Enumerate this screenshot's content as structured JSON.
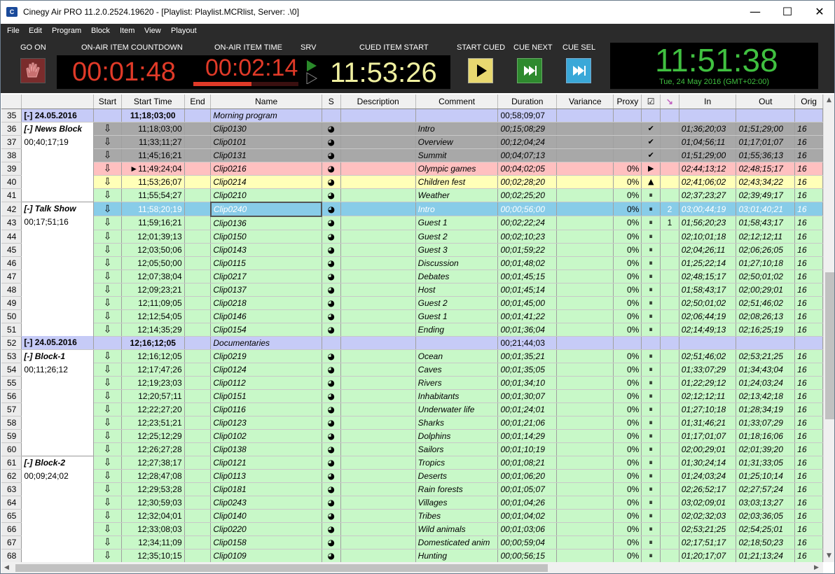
{
  "window": {
    "title": "Cinegy Air PRO 11.2.0.2524.19620 - [Playlist: Playlist.MCRlist, Server: .\\0]",
    "minimize": "—",
    "maximize": "☐",
    "close": "✕"
  },
  "menu": [
    "File",
    "Edit",
    "Program",
    "Block",
    "Item",
    "View",
    "Playout"
  ],
  "toolbar": {
    "go_on_label": "GO ON",
    "countdown_label": "ON-AIR ITEM COUNTDOWN",
    "countdown_value": "00:01:48",
    "item_time_label": "ON-AIR ITEM TIME",
    "item_time_value": "00:02:14",
    "item_progress": 0.55,
    "srv_label": "SRV",
    "cued_label": "CUED ITEM START",
    "cued_value": "11:53:26",
    "start_cued_label": "START CUED",
    "cue_next_label": "CUE NEXT",
    "cue_sel_label": "CUE SEL",
    "clock_time": "11:51:38",
    "clock_date": "Tue, 24 May 2016 (GMT+02:00)"
  },
  "colors": {
    "header_row": "#c6cbf7",
    "done_row": "#a8a8a8",
    "onair_row": "#ffc0c0",
    "cued_row": "#ffffb8",
    "ok_row": "#c8f8c8",
    "selected_row": "#88cce8",
    "clock_green": "#40c040",
    "countdown_red": "#e03a28",
    "cued_yellow": "#f0f0a0"
  },
  "columns": [
    "",
    "",
    "Start",
    "Start Time",
    "End",
    "Name",
    "S",
    "Description",
    "Comment",
    "Duration",
    "Variance",
    "Proxy",
    "☑",
    "↘",
    "In",
    "Out",
    "Orig"
  ],
  "rows": [
    {
      "n": "35",
      "type": "header",
      "block": "[-]  24.05.2016",
      "start": "",
      "time": "11;18;03;00",
      "name": "Morning program",
      "comment": "",
      "dur": "00;58;09;07",
      "proxy": "",
      "chk": "",
      "sel": "",
      "in": "",
      "out": "",
      "orig": ""
    },
    {
      "n": "36",
      "type": "done",
      "block": "[-]  News Block",
      "block2": "00;40;17;19",
      "blockstart": true,
      "start": "⇩",
      "time": "11;18;03;00",
      "name": "Clip0130",
      "s": "◕",
      "comment": "Intro",
      "dur": "00;15;08;29",
      "proxy": "",
      "chk": "✔",
      "sel": "",
      "in": "01;36;20;03",
      "out": "01;51;29;00",
      "orig": "16"
    },
    {
      "n": "37",
      "type": "done",
      "start": "⇩",
      "time": "11;33;11;27",
      "name": "Clip0101",
      "s": "◕",
      "comment": "Overview",
      "dur": "00;12;04;24",
      "proxy": "",
      "chk": "✔",
      "sel": "",
      "in": "01;04;56;11",
      "out": "01;17;01;07",
      "orig": "16"
    },
    {
      "n": "38",
      "type": "done",
      "start": "⇩",
      "time": "11;45;16;21",
      "name": "Clip0131",
      "s": "◕",
      "comment": "Summit",
      "dur": "00;04;07;13",
      "proxy": "",
      "chk": "✔",
      "sel": "",
      "in": "01;51;29;00",
      "out": "01;55;36;13",
      "orig": "16"
    },
    {
      "n": "39",
      "type": "onair",
      "start": "⇩",
      "time": "►11;49;24;04",
      "name": "Clip0216",
      "s": "◕",
      "comment": "Olympic games",
      "dur": "00;04;02;05",
      "proxy": "0%",
      "chk": "▶",
      "sel": "",
      "in": "02;44;13;12",
      "out": "02;48;15;17",
      "orig": "16"
    },
    {
      "n": "40",
      "type": "cued",
      "start": "⇩",
      "time": "11;53;26;07",
      "name": "Clip0214",
      "s": "◕",
      "comment": "Children fest",
      "dur": "00;02;28;20",
      "proxy": "0%",
      "chk": "▲",
      "sel": "",
      "in": "02;41;06;02",
      "out": "02;43;34;22",
      "orig": "16"
    },
    {
      "n": "41",
      "type": "ok",
      "start": "⇩",
      "time": "11;55;54;27",
      "name": "Clip0210",
      "s": "◕",
      "comment": "Weather",
      "dur": "00;02;25;20",
      "proxy": "0%",
      "chk": "⏸",
      "sel": "",
      "in": "02;37;23;27",
      "out": "02;39;49;17",
      "orig": "16"
    },
    {
      "n": "42",
      "type": "selected",
      "block": "[-]  Talk Show",
      "block2": "00;17;51;16",
      "blockstart": true,
      "start": "⇩",
      "time": "11;58;20;19",
      "name": "Clip0240",
      "s": "◕",
      "comment": "Intro",
      "dur": "00;00;56;00",
      "proxy": "0%",
      "chk": "⏸",
      "sel": "2",
      "in": "03;00;44;19",
      "out": "03;01;40;21",
      "orig": "16"
    },
    {
      "n": "43",
      "type": "ok",
      "start": "⇩",
      "time": "11;59;16;21",
      "name": "Clip0136",
      "s": "◕",
      "comment": "Guest 1",
      "dur": "00;02;22;24",
      "proxy": "0%",
      "chk": "⏸",
      "sel": "1",
      "in": "01;56;20;23",
      "out": "01;58;43;17",
      "orig": "16"
    },
    {
      "n": "44",
      "type": "ok",
      "start": "⇩",
      "time": "12;01;39;13",
      "name": "Clip0150",
      "s": "◕",
      "comment": "Guest 2",
      "dur": "00;02;10;23",
      "proxy": "0%",
      "chk": "⏸",
      "sel": "",
      "in": "02;10;01;18",
      "out": "02;12;12;11",
      "orig": "16"
    },
    {
      "n": "45",
      "type": "ok",
      "start": "⇩",
      "time": "12;03;50;06",
      "name": "Clip0143",
      "s": "◕",
      "comment": "Guest 3",
      "dur": "00;01;59;22",
      "proxy": "0%",
      "chk": "⏸",
      "sel": "",
      "in": "02;04;26;11",
      "out": "02;06;26;05",
      "orig": "16"
    },
    {
      "n": "46",
      "type": "ok",
      "start": "⇩",
      "time": "12;05;50;00",
      "name": "Clip0115",
      "s": "◕",
      "comment": "Discussion",
      "dur": "00;01;48;02",
      "proxy": "0%",
      "chk": "⏸",
      "sel": "",
      "in": "01;25;22;14",
      "out": "01;27;10;18",
      "orig": "16"
    },
    {
      "n": "47",
      "type": "ok",
      "start": "⇩",
      "time": "12;07;38;04",
      "name": "Clip0217",
      "s": "◕",
      "comment": "Debates",
      "dur": "00;01;45;15",
      "proxy": "0%",
      "chk": "⏸",
      "sel": "",
      "in": "02;48;15;17",
      "out": "02;50;01;02",
      "orig": "16"
    },
    {
      "n": "48",
      "type": "ok",
      "start": "⇩",
      "time": "12;09;23;21",
      "name": "Clip0137",
      "s": "◕",
      "comment": "Host",
      "dur": "00;01;45;14",
      "proxy": "0%",
      "chk": "⏸",
      "sel": "",
      "in": "01;58;43;17",
      "out": "02;00;29;01",
      "orig": "16"
    },
    {
      "n": "49",
      "type": "ok",
      "start": "⇩",
      "time": "12;11;09;05",
      "name": "Clip0218",
      "s": "◕",
      "comment": "Guest 2",
      "dur": "00;01;45;00",
      "proxy": "0%",
      "chk": "⏸",
      "sel": "",
      "in": "02;50;01;02",
      "out": "02;51;46;02",
      "orig": "16"
    },
    {
      "n": "50",
      "type": "ok",
      "start": "⇩",
      "time": "12;12;54;05",
      "name": "Clip0146",
      "s": "◕",
      "comment": "Guest 1",
      "dur": "00;01;41;22",
      "proxy": "0%",
      "chk": "⏸",
      "sel": "",
      "in": "02;06;44;19",
      "out": "02;08;26;13",
      "orig": "16"
    },
    {
      "n": "51",
      "type": "ok",
      "start": "⇩",
      "time": "12;14;35;29",
      "name": "Clip0154",
      "s": "◕",
      "comment": "Ending",
      "dur": "00;01;36;04",
      "proxy": "0%",
      "chk": "⏸",
      "sel": "",
      "in": "02;14;49;13",
      "out": "02;16;25;19",
      "orig": "16"
    },
    {
      "n": "52",
      "type": "header",
      "block": "[-]  24.05.2016",
      "start": "",
      "time": "12;16;12;05",
      "name": "Documentaries",
      "comment": "",
      "dur": "00;21;44;03",
      "proxy": "",
      "chk": "",
      "sel": "",
      "in": "",
      "out": "",
      "orig": ""
    },
    {
      "n": "53",
      "type": "ok",
      "block": "[-]  Block-1",
      "block2": "00;11;26;12",
      "blockstart": true,
      "start": "⇩",
      "time": "12;16;12;05",
      "name": "Clip0219",
      "s": "◕",
      "comment": "Ocean",
      "dur": "00;01;35;21",
      "proxy": "0%",
      "chk": "⏸",
      "sel": "",
      "in": "02;51;46;02",
      "out": "02;53;21;25",
      "orig": "16"
    },
    {
      "n": "54",
      "type": "ok",
      "start": "⇩",
      "time": "12;17;47;26",
      "name": "Clip0124",
      "s": "◕",
      "comment": "Caves",
      "dur": "00;01;35;05",
      "proxy": "0%",
      "chk": "⏸",
      "sel": "",
      "in": "01;33;07;29",
      "out": "01;34;43;04",
      "orig": "16"
    },
    {
      "n": "55",
      "type": "ok",
      "start": "⇩",
      "time": "12;19;23;03",
      "name": "Clip0112",
      "s": "◕",
      "comment": "Rivers",
      "dur": "00;01;34;10",
      "proxy": "0%",
      "chk": "⏸",
      "sel": "",
      "in": "01;22;29;12",
      "out": "01;24;03;24",
      "orig": "16"
    },
    {
      "n": "56",
      "type": "ok",
      "start": "⇩",
      "time": "12;20;57;11",
      "name": "Clip0151",
      "s": "◕",
      "comment": "Inhabitants",
      "dur": "00;01;30;07",
      "proxy": "0%",
      "chk": "⏸",
      "sel": "",
      "in": "02;12;12;11",
      "out": "02;13;42;18",
      "orig": "16"
    },
    {
      "n": "57",
      "type": "ok",
      "start": "⇩",
      "time": "12;22;27;20",
      "name": "Clip0116",
      "s": "◕",
      "comment": "Underwater life",
      "dur": "00;01;24;01",
      "proxy": "0%",
      "chk": "⏸",
      "sel": "",
      "in": "01;27;10;18",
      "out": "01;28;34;19",
      "orig": "16"
    },
    {
      "n": "58",
      "type": "ok",
      "start": "⇩",
      "time": "12;23;51;21",
      "name": "Clip0123",
      "s": "◕",
      "comment": "Sharks",
      "dur": "00;01;21;06",
      "proxy": "0%",
      "chk": "⏸",
      "sel": "",
      "in": "01;31;46;21",
      "out": "01;33;07;29",
      "orig": "16"
    },
    {
      "n": "59",
      "type": "ok",
      "start": "⇩",
      "time": "12;25;12;29",
      "name": "Clip0102",
      "s": "◕",
      "comment": "Dolphins",
      "dur": "00;01;14;29",
      "proxy": "0%",
      "chk": "⏸",
      "sel": "",
      "in": "01;17;01;07",
      "out": "01;18;16;06",
      "orig": "16"
    },
    {
      "n": "60",
      "type": "ok",
      "start": "⇩",
      "time": "12;26;27;28",
      "name": "Clip0138",
      "s": "◕",
      "comment": "Sailors",
      "dur": "00;01;10;19",
      "proxy": "0%",
      "chk": "⏸",
      "sel": "",
      "in": "02;00;29;01",
      "out": "02;01;39;20",
      "orig": "16"
    },
    {
      "n": "61",
      "type": "ok",
      "block": "[-]  Block-2",
      "block2": "00;09;24;02",
      "blockstart": true,
      "start": "⇩",
      "time": "12;27;38;17",
      "name": "Clip0121",
      "s": "◕",
      "comment": "Tropics",
      "dur": "00;01;08;21",
      "proxy": "0%",
      "chk": "⏸",
      "sel": "",
      "in": "01;30;24;14",
      "out": "01;31;33;05",
      "orig": "16"
    },
    {
      "n": "62",
      "type": "ok",
      "start": "⇩",
      "time": "12;28;47;08",
      "name": "Clip0113",
      "s": "◕",
      "comment": "Deserts",
      "dur": "00;01;06;20",
      "proxy": "0%",
      "chk": "⏸",
      "sel": "",
      "in": "01;24;03;24",
      "out": "01;25;10;14",
      "orig": "16"
    },
    {
      "n": "63",
      "type": "ok",
      "start": "⇩",
      "time": "12;29;53;28",
      "name": "Clip0181",
      "s": "◕",
      "comment": "Rain forests",
      "dur": "00;01;05;07",
      "proxy": "0%",
      "chk": "⏸",
      "sel": "",
      "in": "02;26;52;17",
      "out": "02;27;57;24",
      "orig": "16"
    },
    {
      "n": "64",
      "type": "ok",
      "start": "⇩",
      "time": "12;30;59;03",
      "name": "Clip0243",
      "s": "◕",
      "comment": "Villages",
      "dur": "00;01;04;26",
      "proxy": "0%",
      "chk": "⏸",
      "sel": "",
      "in": "03;02;09;01",
      "out": "03;03;13;27",
      "orig": "16"
    },
    {
      "n": "65",
      "type": "ok",
      "start": "⇩",
      "time": "12;32;04;01",
      "name": "Clip0140",
      "s": "◕",
      "comment": "Tribes",
      "dur": "00;01;04;02",
      "proxy": "0%",
      "chk": "⏸",
      "sel": "",
      "in": "02;02;32;03",
      "out": "02;03;36;05",
      "orig": "16"
    },
    {
      "n": "66",
      "type": "ok",
      "start": "⇩",
      "time": "12;33;08;03",
      "name": "Clip0220",
      "s": "◕",
      "comment": "Wild animals",
      "dur": "00;01;03;06",
      "proxy": "0%",
      "chk": "⏸",
      "sel": "",
      "in": "02;53;21;25",
      "out": "02;54;25;01",
      "orig": "16"
    },
    {
      "n": "67",
      "type": "ok",
      "start": "⇩",
      "time": "12;34;11;09",
      "name": "Clip0158",
      "s": "◕",
      "comment": "Domesticated anim",
      "dur": "00;00;59;04",
      "proxy": "0%",
      "chk": "⏸",
      "sel": "",
      "in": "02;17;51;17",
      "out": "02;18;50;23",
      "orig": "16"
    },
    {
      "n": "68",
      "type": "ok",
      "start": "⇩",
      "time": "12;35;10;15",
      "name": "Clip0109",
      "s": "◕",
      "comment": "Hunting",
      "dur": "00;00;56;15",
      "proxy": "0%",
      "chk": "⏸",
      "sel": "",
      "in": "01;20;17;07",
      "out": "01;21;13;24",
      "orig": "16"
    }
  ]
}
